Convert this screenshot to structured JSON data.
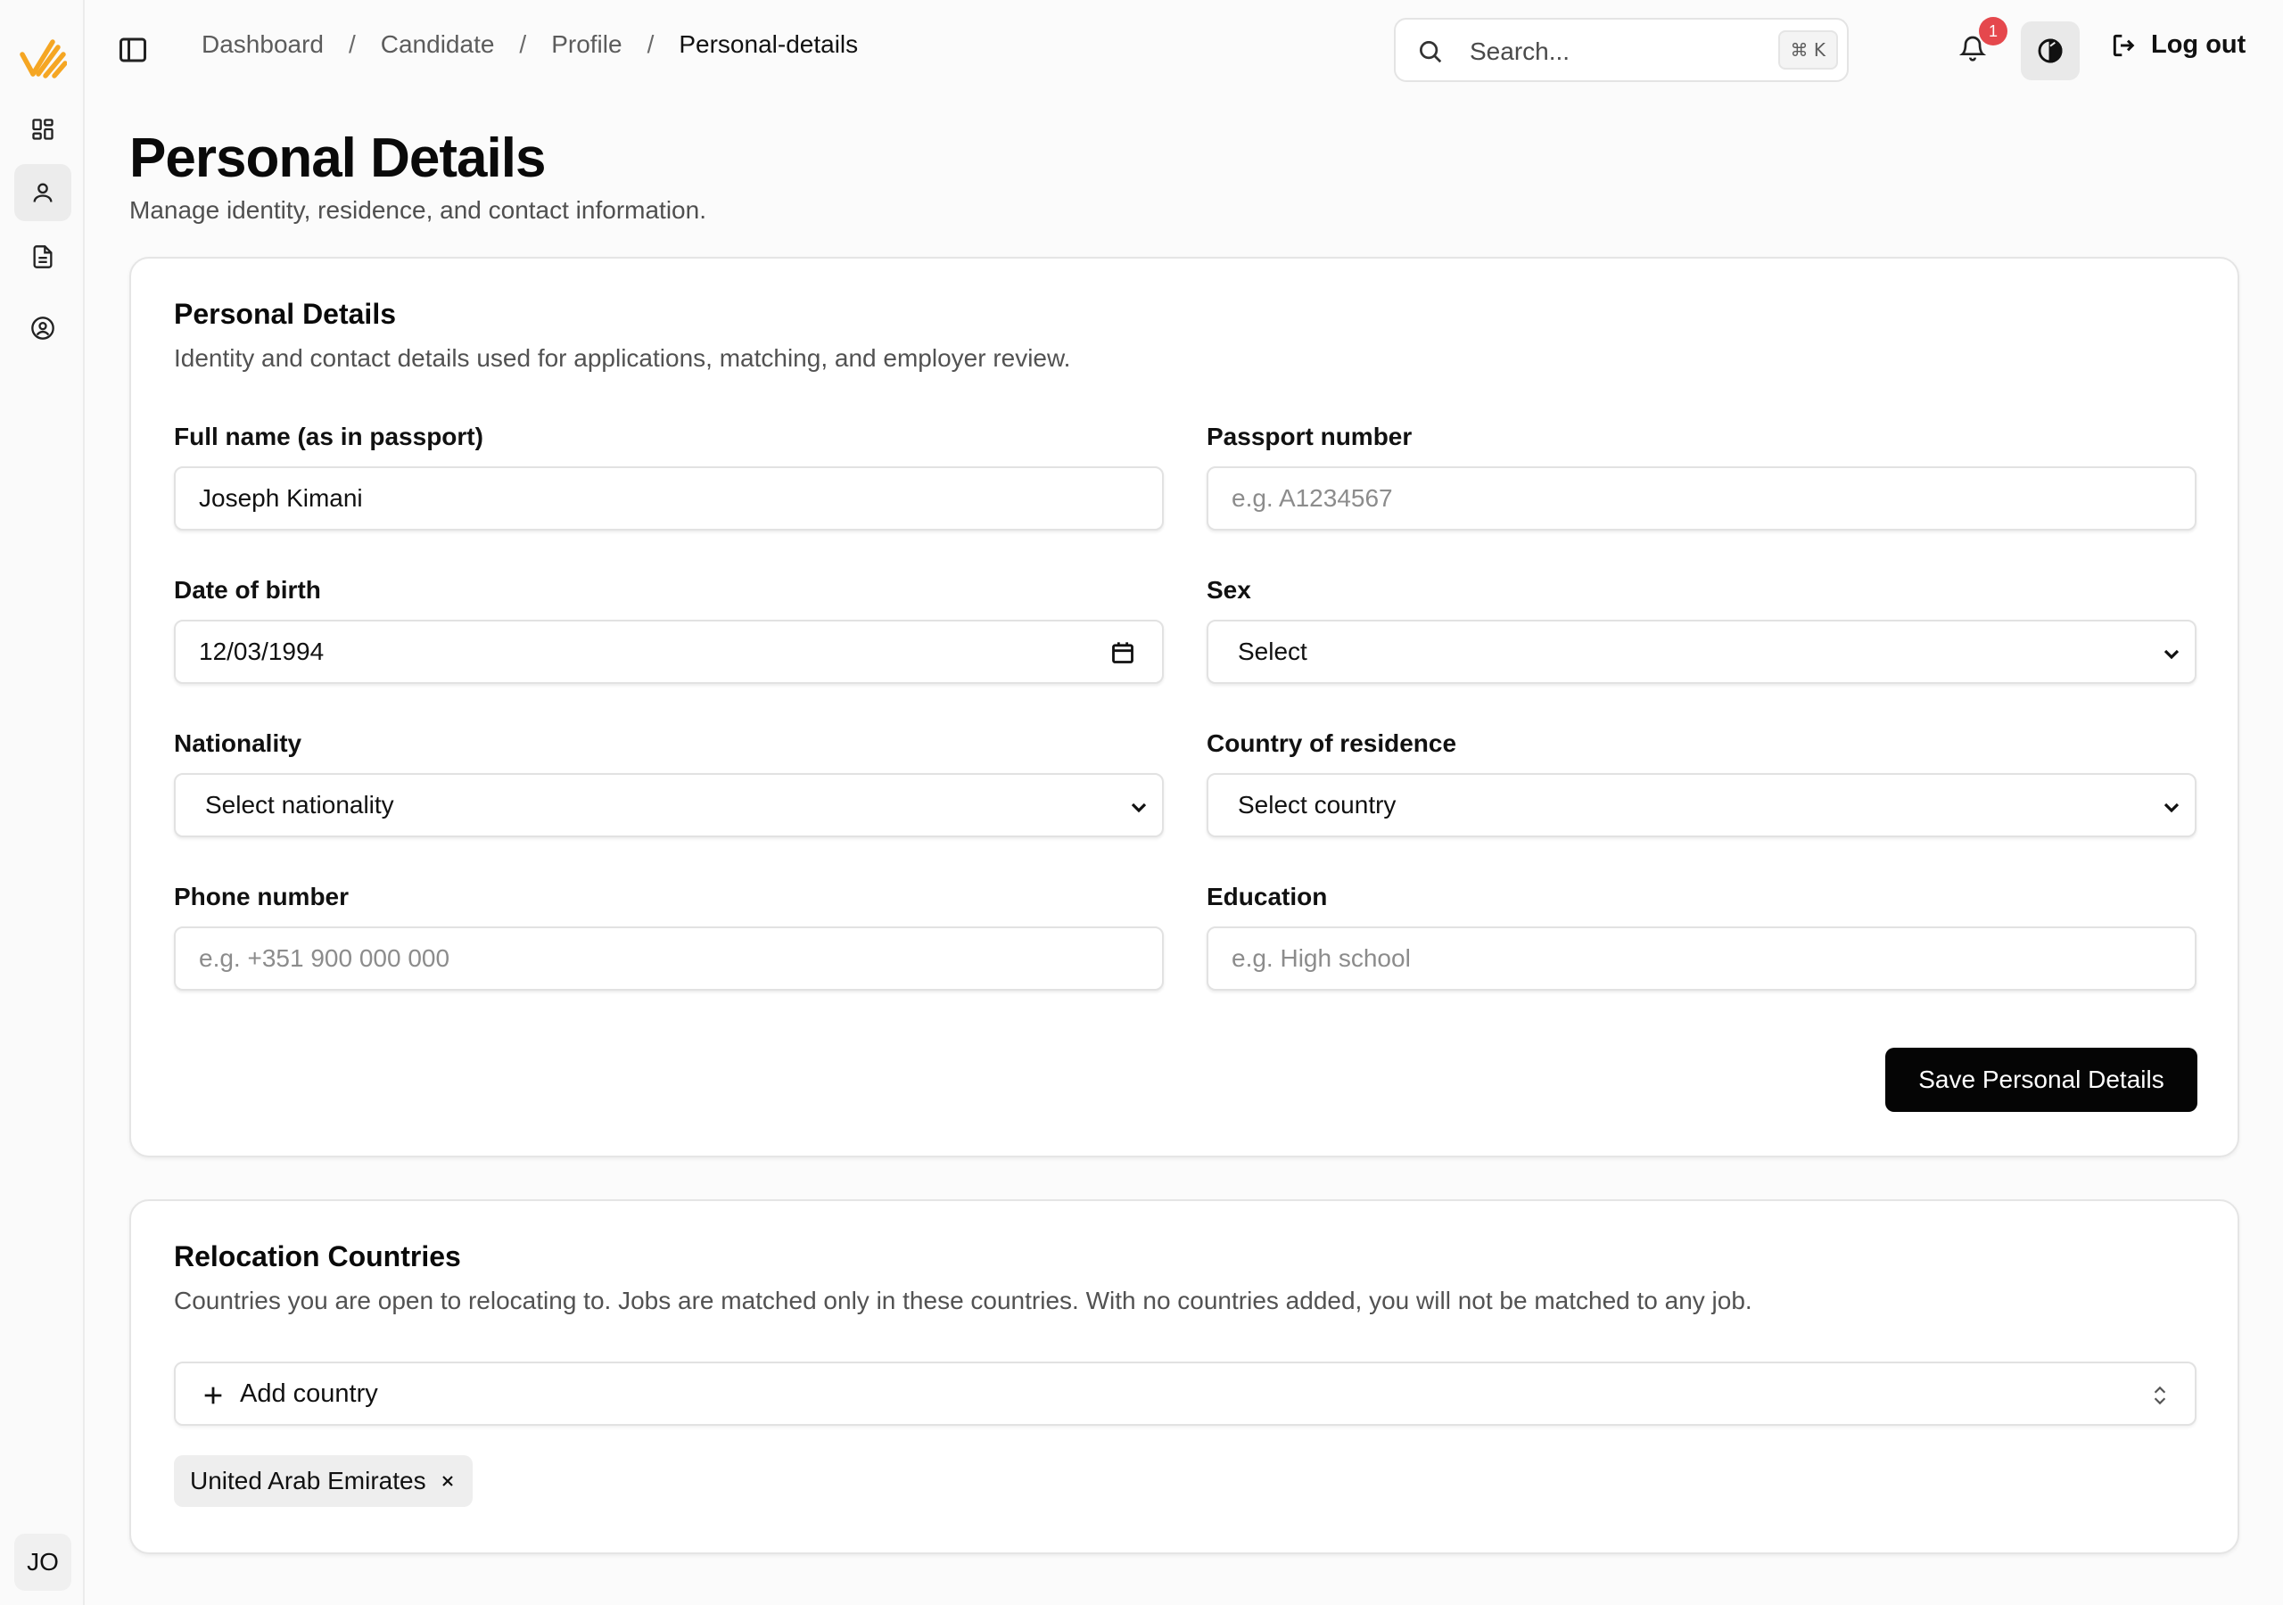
{
  "rail": {
    "items": [
      {
        "icon": "dashboard-icon",
        "active": false
      },
      {
        "icon": "user-icon",
        "active": true
      },
      {
        "icon": "document-icon",
        "active": false
      },
      {
        "icon": "user-circle-icon",
        "active": false
      }
    ],
    "avatar_initials": "JO"
  },
  "topbar": {
    "breadcrumb": [
      "Dashboard",
      "Candidate",
      "Profile",
      "Personal-details"
    ],
    "breadcrumb_separator": "/",
    "search_placeholder": "Search...",
    "search_shortcut": "⌘ K",
    "notification_count": "1",
    "logout_label": "Log out"
  },
  "page": {
    "title": "Personal Details",
    "subtitle": "Manage identity, residence, and contact information."
  },
  "personal_card": {
    "title": "Personal Details",
    "description": "Identity and contact details used for applications, matching, and employer review.",
    "fields": {
      "full_name": {
        "label": "Full name (as in passport)",
        "value": "Joseph Kimani"
      },
      "passport": {
        "label": "Passport number",
        "placeholder": "e.g. A1234567"
      },
      "dob": {
        "label": "Date of birth",
        "value": "12/03/1994"
      },
      "sex": {
        "label": "Sex",
        "value": "Select"
      },
      "nationality": {
        "label": "Nationality",
        "value": "Select nationality"
      },
      "residence": {
        "label": "Country of residence",
        "value": "Select country"
      },
      "phone": {
        "label": "Phone number",
        "placeholder": "e.g. +351 900 000 000"
      },
      "education": {
        "label": "Education",
        "placeholder": "e.g. High school"
      }
    },
    "save_label": "Save Personal Details"
  },
  "relocation_card": {
    "title": "Relocation Countries",
    "description": "Countries you are open to relocating to. Jobs are matched only in these countries. With no countries added, you will not be matched to any job.",
    "add_label": "Add country",
    "countries": [
      "United Arab Emirates"
    ]
  },
  "colors": {
    "accent_logo": "#f5a623",
    "badge": "#e5484d",
    "primary_button": "#050505"
  }
}
